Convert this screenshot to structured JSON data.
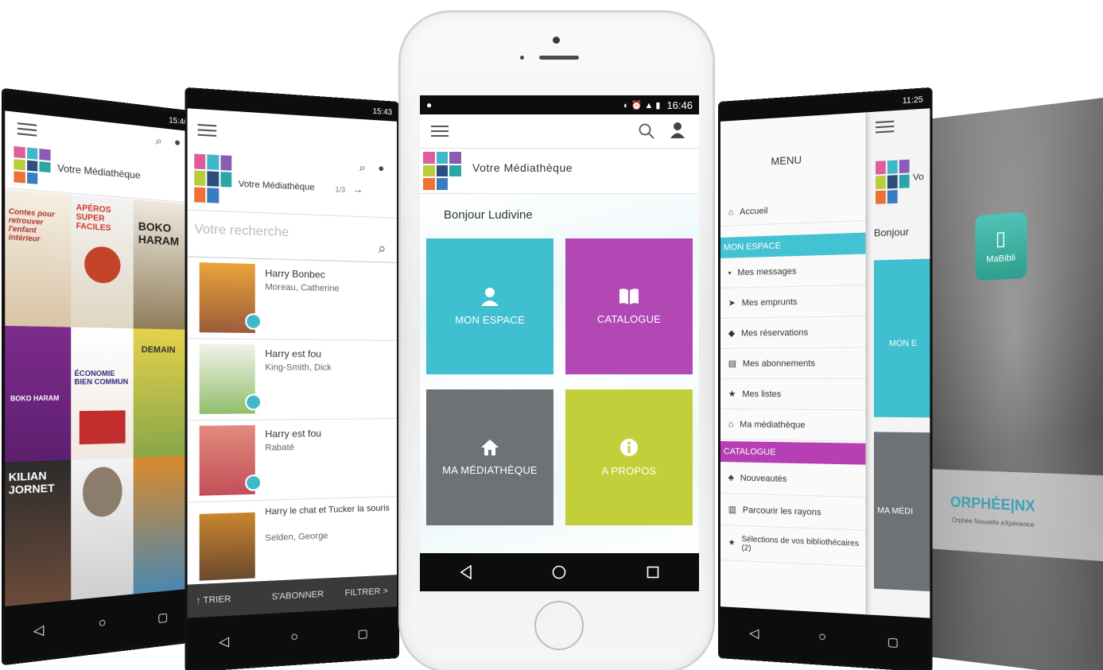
{
  "colors": {
    "accent_cyan": "#3fbfcf",
    "accent_purple": "#b248b4",
    "accent_gray": "#6e7276",
    "accent_lime": "#c3cf3a",
    "bar_black": "#0d0d0d"
  },
  "main_phone": {
    "status_time": "16:46",
    "app_title": "Votre Médiathèque",
    "greeting": "Bonjour Ludivine",
    "tiles": [
      {
        "label": "MON ESPACE",
        "icon": "user-icon"
      },
      {
        "label": "CATALOGUE",
        "icon": "book-icon"
      },
      {
        "label": "MA MÉDIATHÈQUE",
        "icon": "home-icon"
      },
      {
        "label": "A PROPOS",
        "icon": "info-icon"
      }
    ]
  },
  "search_phone": {
    "status_time": "15:43",
    "app_title": "Votre Médiathèque",
    "pager": "1/3",
    "search_placeholder": "Votre recherche",
    "results": [
      {
        "title": "Harry Bonbec",
        "author": "Moreau, Catherine"
      },
      {
        "title": "Harry est fou",
        "author": "King-Smith, Dick"
      },
      {
        "title": "Harry est fou",
        "author": "Rabaté"
      },
      {
        "title": "Harry le chat et Tucker la souris",
        "author": "Selden, George"
      }
    ],
    "bottom_actions": {
      "sort": "↑ TRIER",
      "subscribe": "S'ABONNER",
      "filter": "FILTRER >"
    }
  },
  "shelf_phone": {
    "status_time": "15:46",
    "app_title": "Votre Médiathèque",
    "covers": [
      {
        "text": "Contes pour retrouver l'enfant intérieur"
      },
      {
        "text": "APÉROS SUPER FACILES"
      },
      {
        "text": "BOKO HARAM"
      },
      {
        "text": "BOKO HARAM"
      },
      {
        "text": "ÉCONOMIE BIEN COMMUN"
      },
      {
        "text": "DEMAIN"
      },
      {
        "text": "KILIAN JORNET"
      },
      {
        "text": ""
      },
      {
        "text": ""
      }
    ]
  },
  "menu_phone": {
    "status_time": "11:25",
    "menu_title": "MENU",
    "home_item": "Accueil",
    "section_space": "MON ESPACE",
    "space_items": [
      "Mes messages",
      "Mes emprunts",
      "Mes réservations",
      "Mes abonnements",
      "Mes listes",
      "Ma médiathèque"
    ],
    "section_catalog": "CATALOGUE",
    "catalog_items": [
      "Nouveautés",
      "Parcourir les rayons",
      "Sélections de vos bibliothécaires (2)"
    ],
    "peek_title": "Vo",
    "peek_greeting": "Bonjour",
    "peek_tile_1": "MON E",
    "peek_tile_2": "MA MÉDI"
  },
  "splash": {
    "app_name": "MaBibli",
    "brand": "ORPHÉE|NX",
    "tagline": "Orphée Nouvelle eXpérience"
  }
}
